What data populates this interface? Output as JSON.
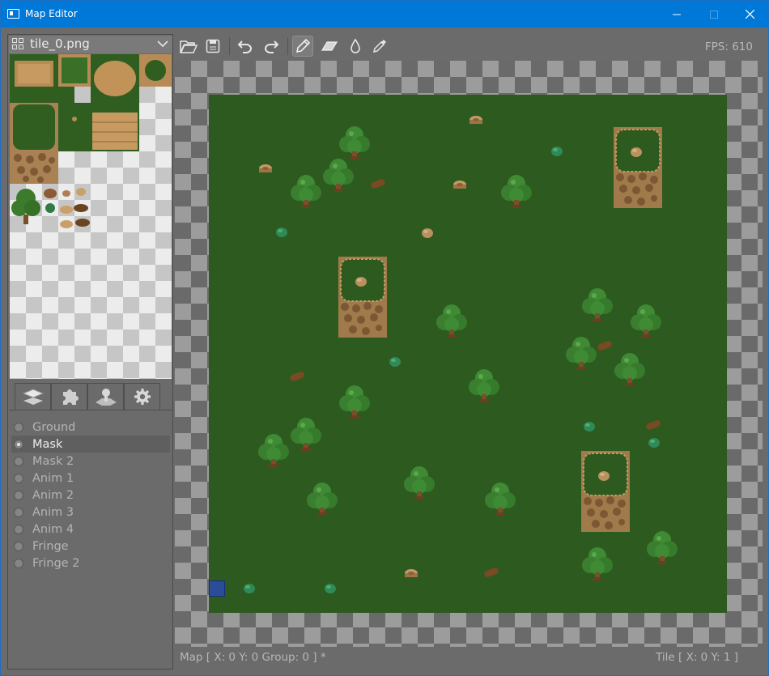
{
  "window": {
    "title": "Map Editor"
  },
  "tileset": {
    "selected": "tile_0.png"
  },
  "tabs": [
    {
      "icon": "layers-icon"
    },
    {
      "icon": "puzzle-icon"
    },
    {
      "icon": "map-pin-icon"
    },
    {
      "icon": "gear-icon"
    }
  ],
  "layers": [
    {
      "label": "Ground",
      "selected": false
    },
    {
      "label": "Mask",
      "selected": true
    },
    {
      "label": "Mask 2",
      "selected": false
    },
    {
      "label": "Anim 1",
      "selected": false
    },
    {
      "label": "Anim 2",
      "selected": false
    },
    {
      "label": "Anim 3",
      "selected": false
    },
    {
      "label": "Anim 4",
      "selected": false
    },
    {
      "label": "Fringe",
      "selected": false
    },
    {
      "label": "Fringe 2",
      "selected": false
    }
  ],
  "toolbar": {
    "tools": [
      "open-icon",
      "save-icon",
      "undo-icon",
      "redo-icon",
      "pencil-icon",
      "eraser-icon",
      "fill-icon",
      "eyedropper-icon"
    ],
    "active_tool": "pencil-icon",
    "fps": "FPS: 610"
  },
  "status": {
    "left": "Map [ X: 0 Y: 0 Group: 0 ] *",
    "right": "Tile [ X: 0 Y: 1 ]"
  },
  "colors": {
    "titlebar": "#0078d7",
    "panel": "#6b6b6b",
    "grass": "#2d5a1e",
    "cursor": "#2a4d9a"
  }
}
